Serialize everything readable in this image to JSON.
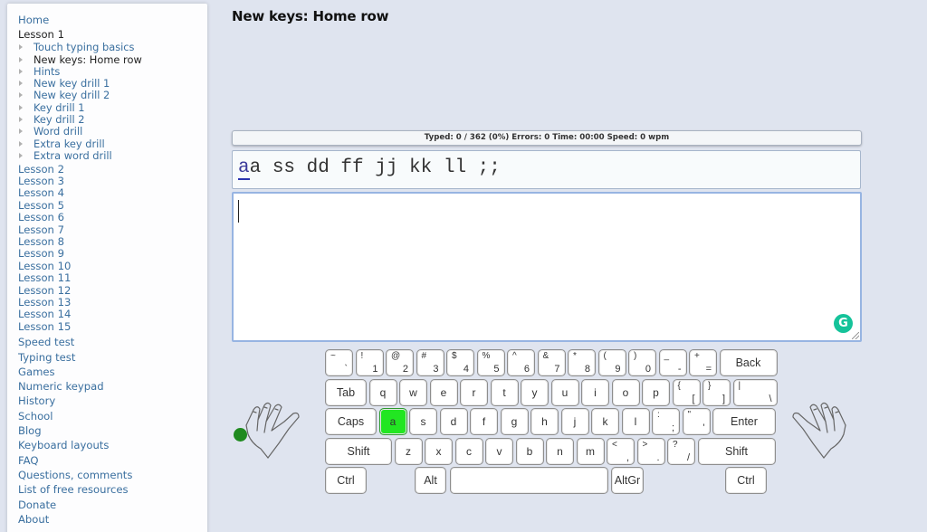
{
  "sidebar": {
    "home": "Home",
    "current_lesson": "Lesson 1",
    "lesson1_items": [
      {
        "label": "Touch typing basics",
        "current": false
      },
      {
        "label": "New keys: Home row",
        "current": true
      },
      {
        "label": "Hints",
        "current": false
      },
      {
        "label": "New key drill 1",
        "current": false
      },
      {
        "label": "New key drill 2",
        "current": false
      },
      {
        "label": "Key drill 1",
        "current": false
      },
      {
        "label": "Key drill 2",
        "current": false
      },
      {
        "label": "Word drill",
        "current": false
      },
      {
        "label": "Extra key drill",
        "current": false
      },
      {
        "label": "Extra word drill",
        "current": false
      }
    ],
    "lessons": [
      "Lesson 2",
      "Lesson 3",
      "Lesson 4",
      "Lesson 5",
      "Lesson 6",
      "Lesson 7",
      "Lesson 8",
      "Lesson 9",
      "Lesson 10",
      "Lesson 11",
      "Lesson 12",
      "Lesson 13",
      "Lesson 14",
      "Lesson 15"
    ],
    "tools": [
      "Speed test",
      "Typing test",
      "Games",
      "Numeric keypad",
      "History",
      "School",
      "Blog",
      "Keyboard layouts",
      "FAQ",
      "Questions, comments",
      "List of free resources",
      "Donate",
      "About"
    ]
  },
  "main": {
    "title": "New keys: Home row",
    "stats": "Typed: 0 / 362 (0%) Errors: 0 Time: 00:00 Speed: 0 wpm",
    "drill_current_char": "a",
    "drill_rest": "a ss dd ff jj kk ll ;;",
    "typing_value": ""
  },
  "keyboard": {
    "active_key": "a",
    "active_color": "#22e622",
    "rows": [
      [
        {
          "top": "~",
          "bot": "`",
          "w": 31
        },
        {
          "top": "!",
          "bot": "1",
          "w": 31
        },
        {
          "top": "@",
          "bot": "2",
          "w": 31
        },
        {
          "top": "#",
          "bot": "3",
          "w": 31
        },
        {
          "top": "$",
          "bot": "4",
          "w": 31
        },
        {
          "top": "%",
          "bot": "5",
          "w": 31
        },
        {
          "top": "^",
          "bot": "6",
          "w": 31
        },
        {
          "top": "&",
          "bot": "7",
          "w": 31
        },
        {
          "top": "*",
          "bot": "8",
          "w": 31
        },
        {
          "top": "(",
          "bot": "9",
          "w": 31
        },
        {
          "top": ")",
          "bot": "0",
          "w": 31
        },
        {
          "top": "_",
          "bot": "-",
          "w": 31
        },
        {
          "top": "+",
          "bot": "=",
          "w": 31
        },
        {
          "label": "Back",
          "w": 64
        }
      ],
      [
        {
          "label": "Tab",
          "w": 46
        },
        {
          "label": "q",
          "w": 31
        },
        {
          "label": "w",
          "w": 31
        },
        {
          "label": "e",
          "w": 31
        },
        {
          "label": "r",
          "w": 31
        },
        {
          "label": "t",
          "w": 31
        },
        {
          "label": "y",
          "w": 31
        },
        {
          "label": "u",
          "w": 31
        },
        {
          "label": "i",
          "w": 31
        },
        {
          "label": "o",
          "w": 31
        },
        {
          "label": "p",
          "w": 31
        },
        {
          "top": "{",
          "bot": "[",
          "w": 31
        },
        {
          "top": "}",
          "bot": "]",
          "w": 31
        },
        {
          "top": "|",
          "bot": "\\",
          "w": 49
        }
      ],
      [
        {
          "label": "Caps",
          "w": 57
        },
        {
          "label": "a",
          "w": 31
        },
        {
          "label": "s",
          "w": 31
        },
        {
          "label": "d",
          "w": 31
        },
        {
          "label": "f",
          "w": 31
        },
        {
          "label": "g",
          "w": 31
        },
        {
          "label": "h",
          "w": 31
        },
        {
          "label": "j",
          "w": 31
        },
        {
          "label": "k",
          "w": 31
        },
        {
          "label": "l",
          "w": 31
        },
        {
          "top": ":",
          "bot": ";",
          "w": 31
        },
        {
          "top": "\"",
          "bot": "'",
          "w": 31
        },
        {
          "label": "Enter",
          "w": 70
        }
      ],
      [
        {
          "label": "Shift",
          "w": 74
        },
        {
          "label": "z",
          "w": 31
        },
        {
          "label": "x",
          "w": 31
        },
        {
          "label": "c",
          "w": 31
        },
        {
          "label": "v",
          "w": 31
        },
        {
          "label": "b",
          "w": 31
        },
        {
          "label": "n",
          "w": 31
        },
        {
          "label": "m",
          "w": 31
        },
        {
          "top": "<",
          "bot": ",",
          "w": 31
        },
        {
          "top": ">",
          "bot": ".",
          "w": 31
        },
        {
          "top": "?",
          "bot": "/",
          "w": 31
        },
        {
          "label": "Shift",
          "w": 86
        }
      ]
    ],
    "bottom": {
      "ctrl_left": "Ctrl",
      "alt": "Alt",
      "space": "",
      "altgr": "AltGr",
      "ctrl_right": "Ctrl"
    }
  }
}
